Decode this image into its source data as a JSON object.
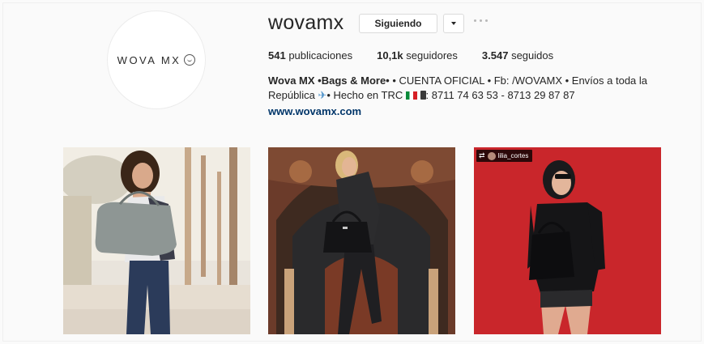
{
  "profile": {
    "logo_text": "WOVA MX",
    "username": "wovamx",
    "follow_label": "Siguiendo"
  },
  "stats": {
    "posts_count": "541",
    "posts_label": "publicaciones",
    "followers_count": "10,1k",
    "followers_label": "seguidores",
    "following_count": "3.547",
    "following_label": "seguidos"
  },
  "bio": {
    "name": "Wova MX •Bags & More•",
    "text_part1": " • CUENTA OFICIAL • Fb: /WOVAMX • Envíos a toda la República ",
    "text_part2": "• Hecho en TRC ",
    "text_part3": ": 8711 74 63 53 - 8713 29 87 87",
    "website": "www.wovamx.com"
  },
  "posts": [
    {
      "id": "post-1"
    },
    {
      "id": "post-2"
    },
    {
      "id": "post-3",
      "repost_user": "lilia_cortes"
    }
  ],
  "colors": {
    "link": "#003569",
    "border": "#dbdbdb",
    "red_wall": "#c9262b"
  }
}
